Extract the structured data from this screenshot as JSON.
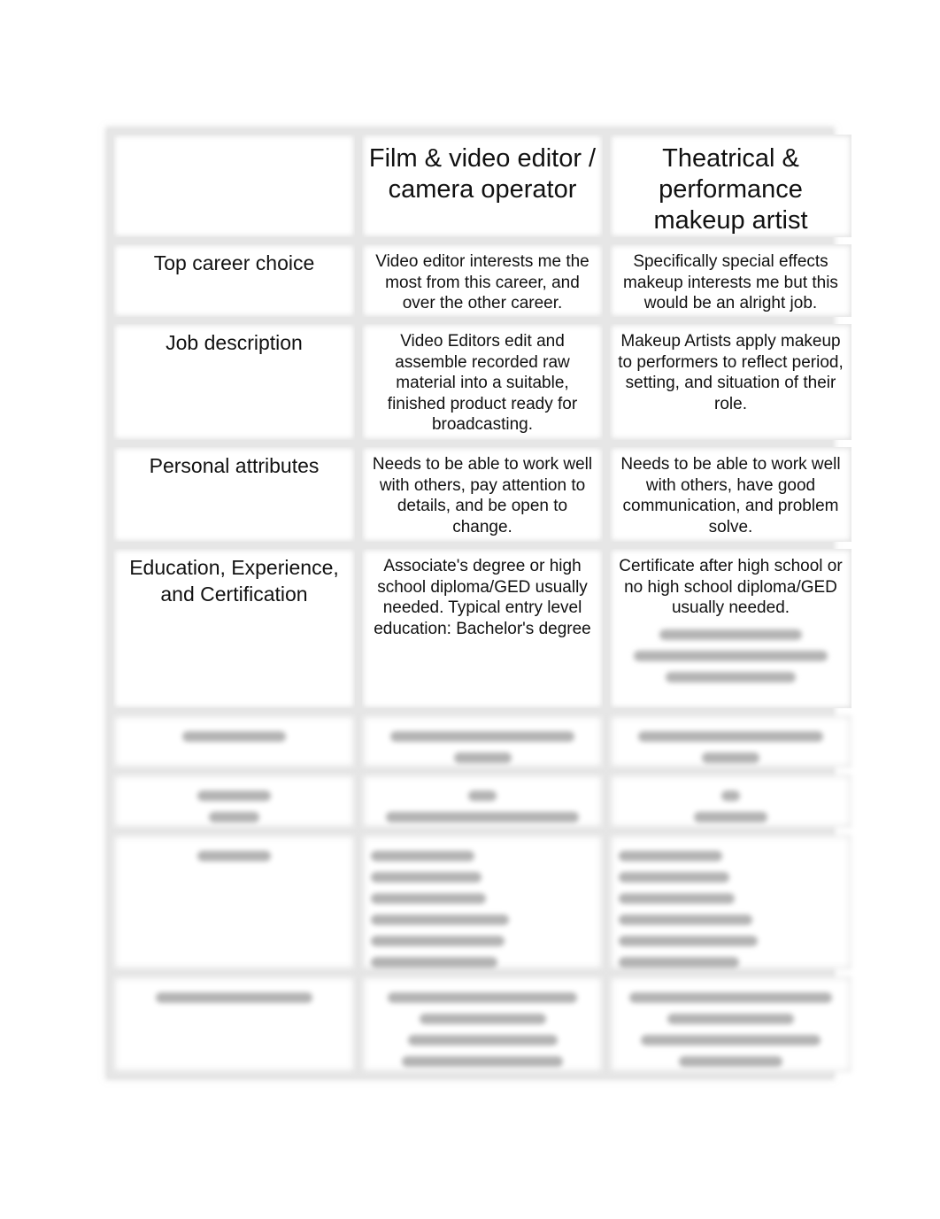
{
  "table": {
    "columns": [
      "",
      "Film & video editor / camera operator",
      "Theatrical & performance makeup artist"
    ],
    "rows": [
      {
        "label": "Top career choice",
        "film": "Video editor interests me the most from this career, and over the other career.",
        "makeup": "Specifically special effects makeup interests me but this would be an alright job."
      },
      {
        "label": "Job description",
        "film": "Video Editors edit and assemble recorded raw material into a suitable, finished product ready for broadcasting.",
        "makeup": "Makeup Artists apply makeup to performers to reflect period, setting, and situation of their role."
      },
      {
        "label": "Personal attributes",
        "film": "Needs to be able to work well with others, pay attention to details, and be open to change.",
        "makeup": "Needs to be able to work well with others, have good communication, and problem solve."
      },
      {
        "label": "Education, Experience, and Certification",
        "film": "Associate's degree or high school diploma/GED usually needed. Typical entry level education: Bachelor's degree",
        "makeup": "Certificate after high school or no high school diploma/GED usually needed.",
        "makeup_obscured_lines": 3
      }
    ],
    "obscured_rows": [
      {
        "label_lines": 1,
        "film_lines": 2,
        "makeup_lines": 2
      },
      {
        "label_lines": 2,
        "film_lines": 2,
        "makeup_lines": 2
      },
      {
        "label_lines": 1,
        "film_lines": 6,
        "makeup_lines": 6
      },
      {
        "label_lines": 1,
        "film_lines": 4,
        "makeup_lines": 4
      }
    ]
  }
}
